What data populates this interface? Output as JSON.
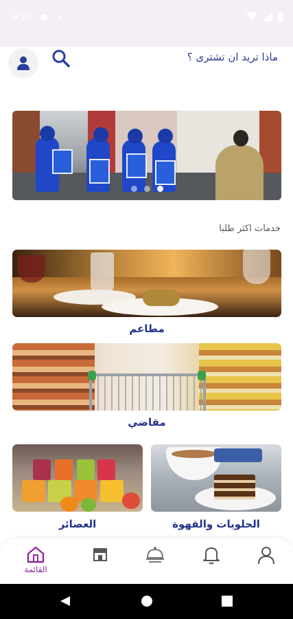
{
  "status_bar": {
    "time": "9:29"
  },
  "header": {
    "title": "ماذا تريد ان تشترى ؟",
    "avatar_icon": "user-icon",
    "search_icon": "search-icon"
  },
  "banner": {
    "slides": 3,
    "active_slide": 3
  },
  "section_title": "خدمات اكثر طلبا",
  "categories": [
    {
      "id": "restaurants",
      "label": "مطاعم"
    },
    {
      "id": "grocery",
      "label": "مقاضي"
    },
    {
      "id": "sweets",
      "label": "الحلويات والقهوة"
    },
    {
      "id": "juice",
      "label": "العصائر"
    }
  ],
  "bottom_nav": {
    "items": [
      {
        "id": "profile",
        "icon": "person-icon"
      },
      {
        "id": "notifications",
        "icon": "bell-icon"
      },
      {
        "id": "orders",
        "icon": "cloche-icon"
      },
      {
        "id": "stores",
        "icon": "store-icon"
      },
      {
        "id": "home",
        "icon": "home-icon",
        "label": "القائمة",
        "active": true
      }
    ]
  },
  "colors": {
    "accent": "#8b2a9c",
    "primary": "#24338a",
    "status_bar": "#f4eef5"
  }
}
